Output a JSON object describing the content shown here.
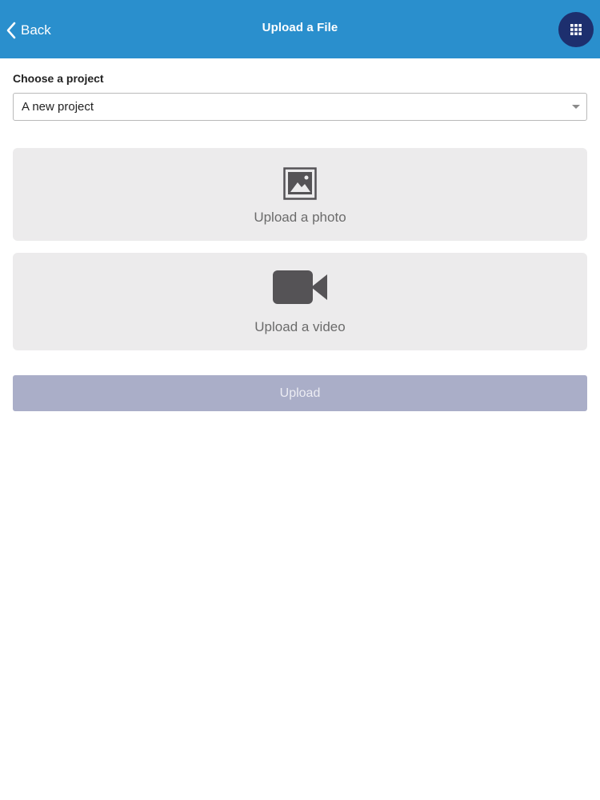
{
  "header": {
    "back_label": "Back",
    "title": "Upload a File",
    "back_icon": "chevron-left-icon",
    "apps_icon": "grid-icon",
    "background_color": "#2a8fcd",
    "apps_button_color": "#1d2f6e"
  },
  "project": {
    "label": "Choose a project",
    "selected": "A new project"
  },
  "upload_options": [
    {
      "label": "Upload a photo",
      "icon": "photo-icon"
    },
    {
      "label": "Upload a video",
      "icon": "video-camera-icon"
    }
  ],
  "upload_button": {
    "label": "Upload",
    "color": "#aaaec8"
  }
}
